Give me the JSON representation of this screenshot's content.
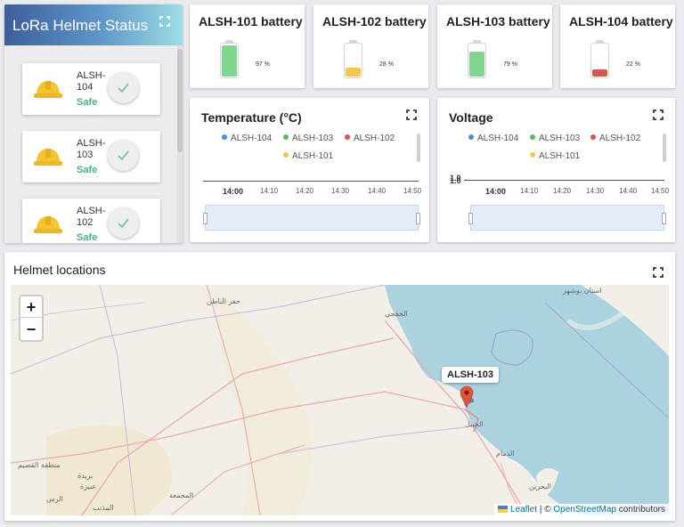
{
  "status_panel": {
    "title": "LoRa Helmet Status",
    "helmets": [
      {
        "name": "ALSH-104",
        "status": "Safe"
      },
      {
        "name": "ALSH-103",
        "status": "Safe"
      },
      {
        "name": "ALSH-102",
        "status": "Safe"
      }
    ]
  },
  "batteries": [
    {
      "title": "ALSH-101 battery",
      "percent_label": "97 %",
      "level": 0.97,
      "color": "#7fd68e"
    },
    {
      "title": "ALSH-102 battery",
      "percent_label": "28 %",
      "level": 0.28,
      "color": "#f2c94c"
    },
    {
      "title": "ALSH-103 battery",
      "percent_label": "79 %",
      "level": 0.79,
      "color": "#7fd68e"
    },
    {
      "title": "ALSH-104 battery",
      "percent_label": "22 %",
      "level": 0.22,
      "color": "#d9534f"
    }
  ],
  "temperature_chart": {
    "title": "Temperature (°C)",
    "legend": [
      {
        "name": "ALSH-104",
        "color": "#4a90d9"
      },
      {
        "name": "ALSH-103",
        "color": "#5cb85c"
      },
      {
        "name": "ALSH-102",
        "color": "#d9534f"
      },
      {
        "name": "ALSH-101",
        "color": "#f2c94c"
      }
    ],
    "x_ticks": [
      "14:00",
      "14:10",
      "14:20",
      "14:30",
      "14:40",
      "14:50"
    ]
  },
  "voltage_chart": {
    "title": "Voltage",
    "legend": [
      {
        "name": "ALSH-104",
        "color": "#4a90d9"
      },
      {
        "name": "ALSH-103",
        "color": "#5cb85c"
      },
      {
        "name": "ALSH-102",
        "color": "#d9534f"
      },
      {
        "name": "ALSH-101",
        "color": "#f2c94c"
      }
    ],
    "x_ticks": [
      "14:00",
      "14:10",
      "14:20",
      "14:30",
      "14:40",
      "14:50"
    ],
    "y_tick_overlap": "1.0"
  },
  "map_panel": {
    "title": "Helmet locations",
    "zoom_in": "+",
    "zoom_out": "−",
    "marker_label": "ALSH-103",
    "attribution": {
      "leaflet": "Leaflet",
      "separator": " | © ",
      "osm": "OpenStreetMap",
      "suffix": " contributors"
    },
    "place_labels": [
      "حفر الباطن",
      "الخفجي",
      "الجبيل",
      "الدمام",
      "البحرين",
      "بريدة",
      "منطقة القصيم",
      "المجمعة",
      "عنيزة",
      "الرس",
      "المذنب",
      "استان بوشهر"
    ]
  },
  "icons": {
    "expand": "expand-icon",
    "check": "check-icon",
    "helmet": "hard-hat-icon",
    "marker": "map-pin-icon"
  },
  "colors": {
    "header_gradient_start": "#3d5f9c",
    "header_gradient_end": "#9ddde4",
    "safe_green": "#4caf7d",
    "helmet_yellow": "#f4c430",
    "sea": "#abd3df",
    "marker_red": "#e0533a"
  }
}
